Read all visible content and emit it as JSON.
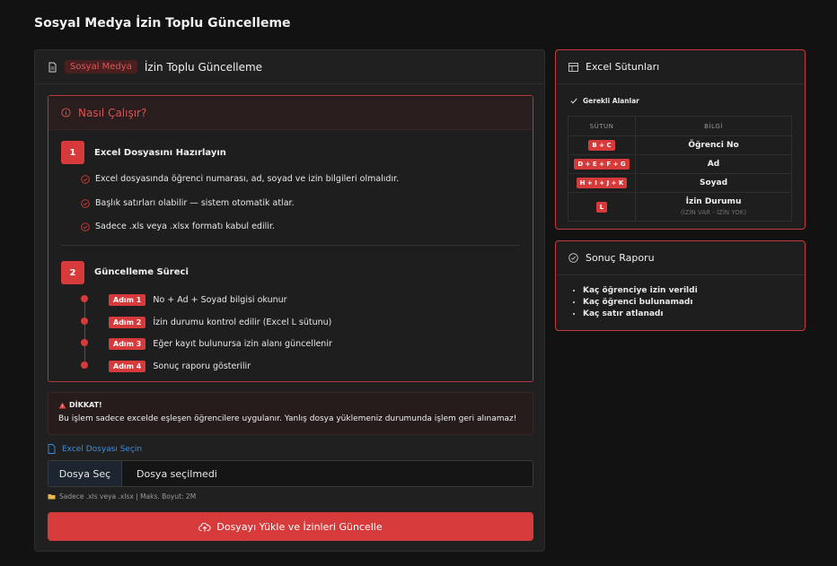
{
  "page": {
    "title": "Sosyal Medya İzin Toplu Güncelleme"
  },
  "main": {
    "badge": "Sosyal Medya",
    "title": "İzin Toplu Güncelleme",
    "how": {
      "title": "Nasıl Çalışır?",
      "step1": {
        "num": "1",
        "title": "Excel Dosyasını Hazırlayın",
        "items": [
          "Excel dosyasında öğrenci numarası, ad, soyad ve izin bilgileri olmalıdır.",
          "Başlık satırları olabilir — sistem otomatik atlar.",
          "Sadece .xls veya .xlsx formatı kabul edilir."
        ]
      },
      "step2": {
        "num": "2",
        "title": "Güncelleme Süreci",
        "steps": [
          {
            "badge": "Adım 1",
            "text": "No + Ad + Soyad bilgisi okunur"
          },
          {
            "badge": "Adım 2",
            "text": "İzin durumu kontrol edilir (Excel L sütunu)"
          },
          {
            "badge": "Adım 3",
            "text": "Eğer kayıt bulunursa izin alanı güncellenir"
          },
          {
            "badge": "Adım 4",
            "text": "Sonuç raporu gösterilir"
          }
        ]
      }
    },
    "warning": {
      "title": "DİKKAT!",
      "text": "Bu işlem sadece excelde eşleşen öğrencilere uygulanır. Yanlış dosya yüklemeniz durumunda işlem geri alınamaz!"
    },
    "file": {
      "label": "Excel Dosyası Seçin",
      "button": "Dosya Seç",
      "status": "Dosya seçilmedi",
      "hint": "Sadece .xls veya .xlsx | Maks. Boyut: 2M"
    },
    "upload_label": "Dosyayı Yükle ve İzinleri Güncelle"
  },
  "columns_card": {
    "title": "Excel Sütunları",
    "required": "Gerekli Alanlar",
    "headers": [
      "SÜTUN",
      "BİLGİ"
    ],
    "rows": [
      {
        "col": "B + C",
        "info": "Öğrenci No",
        "sub": ""
      },
      {
        "col": "D + E + F + G",
        "info": "Ad",
        "sub": ""
      },
      {
        "col": "H + I + J + K",
        "info": "Soyad",
        "sub": ""
      },
      {
        "col": "L",
        "info": "İzin Durumu",
        "sub": "(İZİN VAR - İZİN YOK)"
      }
    ]
  },
  "report_card": {
    "title": "Sonuç Raporu",
    "items": [
      "Kaç öğrenciye izin verildi",
      "Kaç öğrenci bulunamadı",
      "Kaç satır atlanadı"
    ]
  },
  "colors": {
    "accent": "#d63a3a",
    "link": "#3a8ee0",
    "background": "#121212",
    "card": "#202020"
  }
}
